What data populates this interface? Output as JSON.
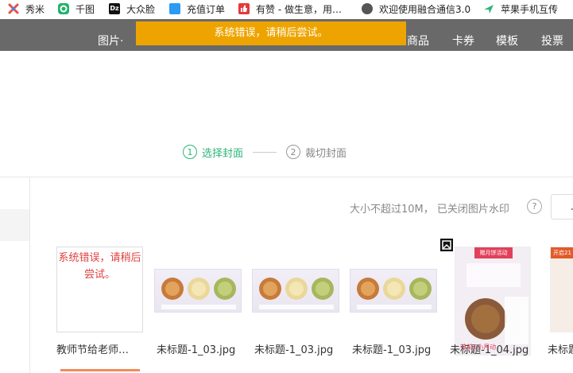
{
  "bookmarks": [
    {
      "label": "秀米",
      "icon": "xiumi-icon",
      "color": "#e84f4f"
    },
    {
      "label": "千图",
      "icon": "qiantu-icon",
      "color": "#1fb26b"
    },
    {
      "label": "大众脸",
      "icon": "dz-icon",
      "color": "#111111"
    },
    {
      "label": "充值订单",
      "icon": "recharge-icon",
      "color": "#2b9bf4"
    },
    {
      "label": "有赞 - 做生意，用…",
      "icon": "youzan-icon",
      "color": "#e4393c"
    },
    {
      "label": "欢迎使用融合通信3.0",
      "icon": "globe-icon",
      "color": "#444444"
    },
    {
      "label": "苹果手机互传",
      "icon": "arrow-icon",
      "color": "#2eb37a"
    }
  ],
  "nav": {
    "items": [
      "图片·",
      "商品",
      "卡券",
      "模板",
      "投票"
    ]
  },
  "toast": {
    "text": "系统错误，请稍后尝试。"
  },
  "steps": [
    {
      "num": "1",
      "label": "选择封面"
    },
    {
      "num": "2",
      "label": "裁切封面"
    }
  ],
  "hint": {
    "text": "大小不超过10M， 已关闭图片水印",
    "help": "?"
  },
  "upload_label": "上",
  "thumbnails": [
    {
      "caption": "教师节给老师…",
      "error_text": "系统错误，请稍后尝试。"
    },
    {
      "caption": "未标题-1_03.jpg"
    },
    {
      "caption": "未标题-1_03.jpg"
    },
    {
      "caption": "未标题-1_03.jpg"
    },
    {
      "caption": "未标题-1_04.jpg",
      "poster_title": "赠月饼活动",
      "poster_sub": "节前1小月动"
    },
    {
      "caption": "未标题",
      "poster_title": "开启21"
    }
  ],
  "colors": {
    "accent_green": "#2eb37a",
    "nav_gray": "#696969",
    "toast_orange": "#eea400",
    "error_red": "#e04040"
  }
}
